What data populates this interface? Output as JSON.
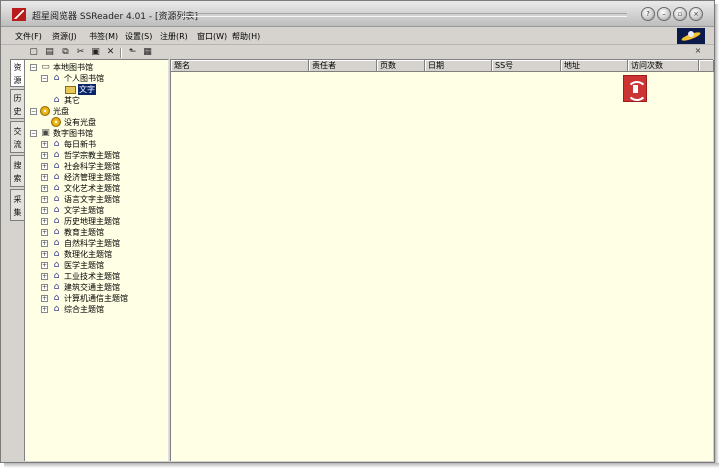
{
  "window": {
    "title": "超星阅览器 SSReader 4.01 - [资源列表]",
    "buttons": [
      "?",
      "–",
      "▫",
      "×"
    ]
  },
  "menu": {
    "items": [
      "文件(F)",
      "资源(J)",
      "书签(M)",
      "设置(S)",
      "注册(R)",
      "窗口(W)",
      "帮助(H)"
    ]
  },
  "toolbar": {
    "icons": [
      "new-page-icon",
      "add-resource-icon",
      "copy-icon",
      "cut-icon",
      "paste-icon",
      "delete-icon",
      "up-folder-icon",
      "properties-icon"
    ],
    "glyphs": [
      "▢",
      "▤",
      "⧉",
      "✂",
      "▣",
      "✕",
      "⬑",
      "▦"
    ],
    "close_glyph": "×"
  },
  "vertical_tabs": [
    {
      "label": "资源",
      "active": true
    },
    {
      "label": "历史",
      "active": false
    },
    {
      "label": "交流",
      "active": false
    },
    {
      "label": "搜索",
      "active": false
    },
    {
      "label": "采集",
      "active": false
    }
  ],
  "tree": {
    "local_library": {
      "label": "本地图书馆",
      "children": [
        {
          "label": "个人图书馆",
          "children": [
            {
              "label": "文字",
              "selected": true
            }
          ]
        },
        {
          "label": "其它"
        }
      ]
    },
    "cdrom": {
      "label": "光盘",
      "children": [
        {
          "label": "没有光盘"
        }
      ]
    },
    "digital_library": {
      "label": "数字图书馆",
      "children": [
        "每日新书",
        "哲学宗教主题馆",
        "社会科学主题馆",
        "经济管理主题馆",
        "文化艺术主题馆",
        "语言文字主题馆",
        "文学主题馆",
        "历史地理主题馆",
        "教育主题馆",
        "自然科学主题馆",
        "数理化主题馆",
        "医学主题馆",
        "工业技术主题馆",
        "建筑交通主题馆",
        "计算机通信主题馆",
        "综合主题馆"
      ]
    },
    "expander_open": "−",
    "expander_closed": "+"
  },
  "list": {
    "columns": [
      "题名",
      "责任者",
      "页数",
      "日期",
      "SS号",
      "地址",
      "访问次数"
    ],
    "rows": []
  },
  "colors": {
    "panel_background": "#ffffe5",
    "window_chrome": "#d6d3ce",
    "selection": "#0a246a",
    "logo_red": "#b81c1c"
  }
}
